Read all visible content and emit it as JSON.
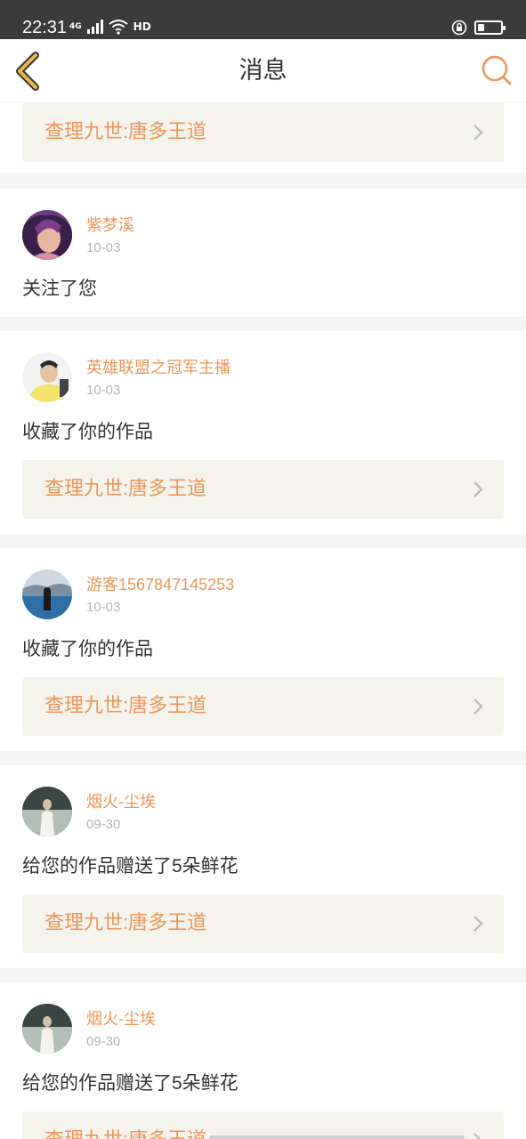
{
  "status_bar": {
    "time": "22:31",
    "network": "4G",
    "hd": "HD",
    "battery_level": 0.3,
    "icons": [
      "signal-icon",
      "wifi-icon",
      "hd-icon",
      "lock-rotation-icon",
      "battery-icon"
    ]
  },
  "nav": {
    "title": "消息",
    "back_icon": "chevron-left-icon",
    "search_icon": "search-icon",
    "accent": "#f0955a"
  },
  "notifications": [
    {
      "user": "",
      "date": "",
      "action": "",
      "work_title": "查理九世:唐多王道"
    },
    {
      "user": "紫梦溪",
      "date": "10-03",
      "action": "关注了您",
      "work_title": ""
    },
    {
      "user": "英雄联盟之冠军主播",
      "date": "10-03",
      "action": "收藏了你的作品",
      "work_title": "查理九世:唐多王道"
    },
    {
      "user": "游客1567847145253",
      "date": "10-03",
      "action": "收藏了你的作品",
      "work_title": "查理九世:唐多王道"
    },
    {
      "user": "烟火-尘埃",
      "date": "09-30",
      "action": "给您的作品赠送了5朵鲜花",
      "work_title": "查理九世:唐多王道"
    },
    {
      "user": "烟火-尘埃",
      "date": "09-30",
      "action": "给您的作品赠送了5朵鲜花",
      "work_title": "查理九世:唐多王道"
    }
  ],
  "colors": {
    "accent": "#f0955a",
    "link_background": "#f4f4ec",
    "status_bar": "#3b3b3b",
    "back_icon": "#e9b84a"
  }
}
